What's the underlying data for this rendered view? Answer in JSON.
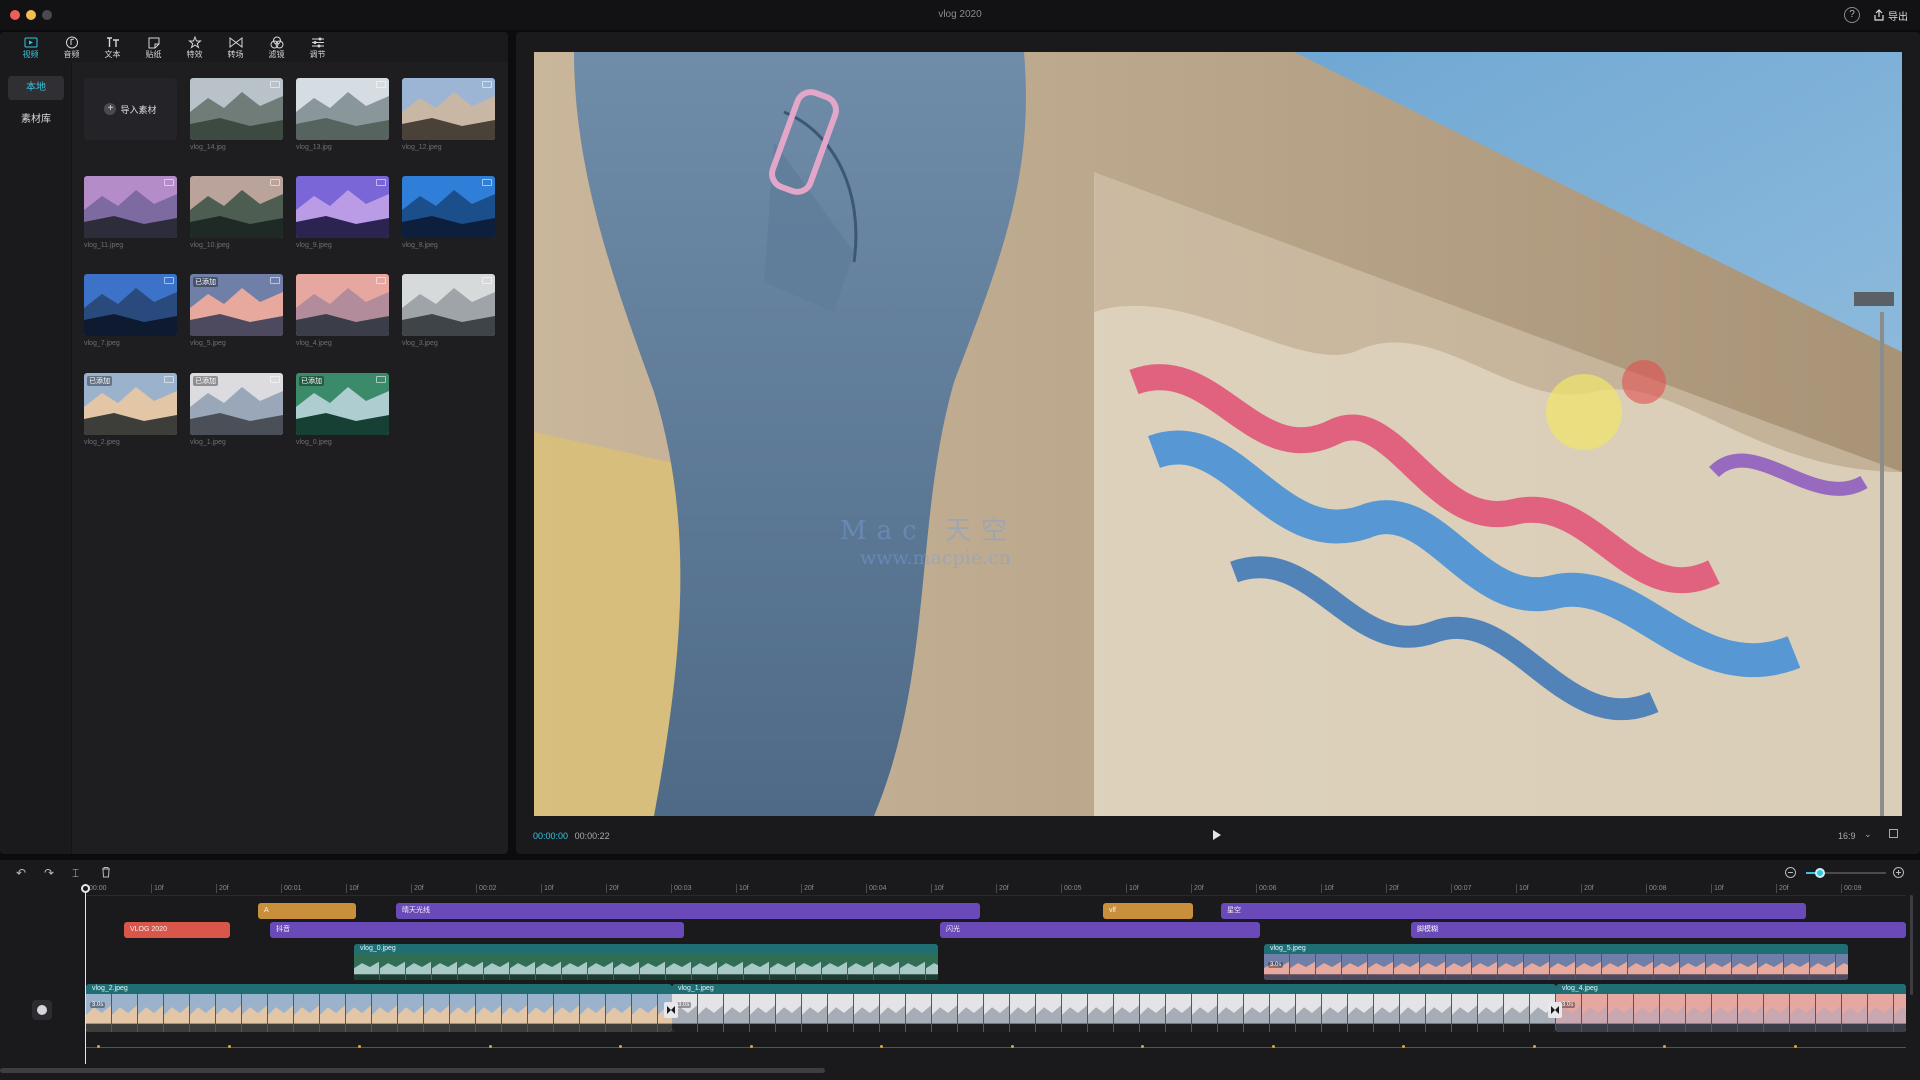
{
  "window": {
    "title": "vlog 2020",
    "help": "?",
    "export_label": "导出"
  },
  "media_tabs": [
    {
      "label": "视频",
      "icon": "video-icon",
      "active": true
    },
    {
      "label": "音频",
      "icon": "audio-icon"
    },
    {
      "label": "文本",
      "icon": "text-icon"
    },
    {
      "label": "贴纸",
      "icon": "sticker-icon"
    },
    {
      "label": "特效",
      "icon": "effects-icon"
    },
    {
      "label": "转场",
      "icon": "transition-icon"
    },
    {
      "label": "滤镜",
      "icon": "filter-icon"
    },
    {
      "label": "调节",
      "icon": "adjust-icon"
    }
  ],
  "media_sidebar": [
    {
      "label": "本地",
      "active": true
    },
    {
      "label": "素材库"
    }
  ],
  "media_library": {
    "import_label": "导入素材",
    "items": [
      {
        "name": "vlog_14.jpg",
        "colors": [
          "#b8c2c8",
          "#6f7c78",
          "#3d4a42"
        ]
      },
      {
        "name": "vlog_13.jpg",
        "colors": [
          "#d6dde2",
          "#8a979a",
          "#56635e"
        ]
      },
      {
        "name": "vlog_12.jpeg",
        "colors": [
          "#9cb5d4",
          "#c7b7a4",
          "#4a4138"
        ]
      },
      {
        "name": "vlog_11.jpeg",
        "colors": [
          "#b48cc8",
          "#7d6aa0",
          "#2d2c3a"
        ]
      },
      {
        "name": "vlog_10.jpeg",
        "colors": [
          "#b9a39b",
          "#4e5d52",
          "#1f2a26"
        ]
      },
      {
        "name": "vlog_9.jpeg",
        "colors": [
          "#7a66d6",
          "#b99be6",
          "#2b2350"
        ]
      },
      {
        "name": "vlog_8.jpeg",
        "colors": [
          "#2f7ed8",
          "#1b4f8c",
          "#0d1f3c"
        ]
      },
      {
        "name": "vlog_7.jpeg",
        "colors": [
          "#3c72c8",
          "#2a4a7e",
          "#0e1a30"
        ]
      },
      {
        "name": "vlog_5.jpeg",
        "badge": "已添加",
        "colors": [
          "#6f7fa8",
          "#e7a99d",
          "#4d4a60"
        ]
      },
      {
        "name": "vlog_4.jpeg",
        "colors": [
          "#e5a79f",
          "#b28c9a",
          "#3b3d48"
        ]
      },
      {
        "name": "vlog_3.jpeg",
        "colors": [
          "#d7dadb",
          "#9ea4a8",
          "#3e4448"
        ]
      },
      {
        "name": "vlog_2.jpeg",
        "badge": "已添加",
        "colors": [
          "#9bb2cc",
          "#e2c6a6",
          "#3d3d3a"
        ]
      },
      {
        "name": "vlog_1.jpeg",
        "badge": "已添加",
        "colors": [
          "#dcdce0",
          "#9aa7b8",
          "#4b5058"
        ]
      },
      {
        "name": "vlog_0.jpeg",
        "badge": "已添加",
        "colors": [
          "#3b8a6a",
          "#aecdd0",
          "#174034"
        ]
      }
    ]
  },
  "preview": {
    "current_time": "00:00:00",
    "total_time": "00:00:22",
    "ratio": "16:9",
    "watermark_line1": "Mac 天空",
    "watermark_line2": "www.macpie.cn"
  },
  "timeline": {
    "ruler": [
      "00:00",
      "10f",
      "20f",
      "00:01",
      "10f",
      "20f",
      "00:02",
      "10f",
      "20f",
      "00:03",
      "10f",
      "20f",
      "00:04",
      "10f",
      "20f",
      "00:05",
      "10f",
      "20f",
      "00:06",
      "10f",
      "20f",
      "00:07",
      "10f",
      "20f",
      "00:08",
      "10f",
      "20f",
      "00:09"
    ],
    "text_clips": [
      {
        "label": "A",
        "color": "gold"
      },
      {
        "label": "晴天光线",
        "color": "purple"
      },
      {
        "label": "vlf",
        "color": "gold"
      },
      {
        "label": "星空",
        "color": "purple"
      }
    ],
    "sticker_clips": [
      {
        "label": "VLOG 2020",
        "color": "red"
      },
      {
        "label": "抖音",
        "color": "purple"
      },
      {
        "label": "闪光",
        "color": "purple"
      },
      {
        "label": "脚模糊",
        "color": "purple"
      }
    ],
    "overlay_clips": [
      {
        "label": "vlog_0.jpeg",
        "colors": [
          "#2f6e55",
          "#a9c9c6",
          "#1b3d31"
        ]
      },
      {
        "label": "vlog_5.jpeg",
        "duration": "3.0s",
        "colors": [
          "#6f7fa8",
          "#e7a99d",
          "#4d4a60"
        ]
      }
    ],
    "main_clips": [
      {
        "label": "vlog_2.jpeg",
        "duration": "3.0s",
        "colors": [
          "#9bb2cc",
          "#e2c6a6",
          "#3d3d3a"
        ]
      },
      {
        "label": "vlog_1.jpeg",
        "duration": "3.0s",
        "colors": [
          "#e4e4e6",
          "#a6adb6",
          "#1e1e22"
        ]
      },
      {
        "label": "vlog_4.jpeg",
        "duration": "3.0s",
        "colors": [
          "#e5a79f",
          "#c9a7b0",
          "#3b3d48"
        ]
      }
    ]
  }
}
